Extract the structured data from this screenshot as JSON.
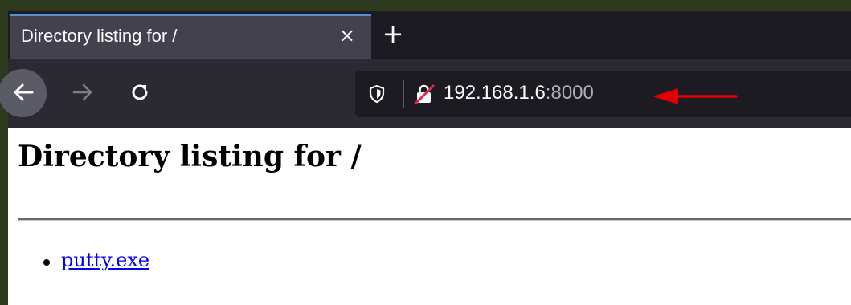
{
  "tab": {
    "title": "Directory listing for /",
    "close_glyph": "×",
    "new_tab_glyph": "+"
  },
  "toolbar": {
    "back_icon": "arrow-left-icon",
    "forward_icon": "arrow-right-icon",
    "reload_icon": "reload-icon"
  },
  "urlbar": {
    "shield_icon": "shield-icon",
    "lock_icon": "insecure-lock-icon",
    "host": "192.168.1.6",
    "port": ":8000"
  },
  "page": {
    "heading": "Directory listing for /",
    "files": [
      {
        "name": "putty.exe"
      }
    ]
  },
  "colors": {
    "annotation_arrow": "#e00000",
    "link": "#0000ee",
    "tab_accent": "#5a8dd6"
  }
}
